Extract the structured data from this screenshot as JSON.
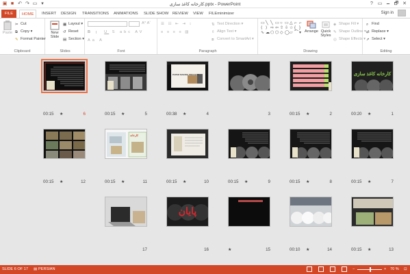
{
  "window": {
    "title": "کارخانه کاغذ سازی.pptx - PowerPoint",
    "help": "?",
    "controls": [
      "🗕",
      "🗗",
      "✕"
    ]
  },
  "tabs": [
    "FILE",
    "HOME",
    "INSERT",
    "DESIGN",
    "TRANSITIONS",
    "ANIMATIONS",
    "SLIDE SHOW",
    "REVIEW",
    "VIEW",
    "FILEminimizer"
  ],
  "active_tab": "HOME",
  "sign_in": "Sign in",
  "ribbon": {
    "clipboard": {
      "paste": "Paste",
      "cut": "Cut",
      "copy": "Copy",
      "format_painter": "Format Painter",
      "label": "Clipboard"
    },
    "slides": {
      "new_slide": "New Slide",
      "layout": "Layout",
      "reset": "Reset",
      "section": "Section",
      "label": "Slides"
    },
    "font": {
      "label": "Font"
    },
    "paragraph": {
      "text_direction": "Text Direction",
      "align_text": "Align Text",
      "convert_smartart": "Convert to SmartArt",
      "label": "Paragraph"
    },
    "drawing": {
      "arrange": "Arrange",
      "quick_styles": "Quick Styles",
      "shape_fill": "Shape Fill",
      "shape_outline": "Shape Outline",
      "shape_effects": "Shape Effects",
      "label": "Drawing"
    },
    "editing": {
      "find": "Find",
      "replace": "Replace",
      "select": "Select",
      "label": "Editing"
    }
  },
  "slides": [
    {
      "number": "6",
      "time": "00:15",
      "star": "★",
      "selected": true
    },
    {
      "number": "5",
      "time": "00:15",
      "star": "★"
    },
    {
      "number": "4",
      "time": "00:38",
      "star": "★"
    },
    {
      "number": "3",
      "time": "",
      "star": ""
    },
    {
      "number": "2",
      "time": "00:15",
      "star": "★"
    },
    {
      "number": "1",
      "time": "00:20",
      "star": "★"
    },
    {
      "number": "12",
      "time": "00:15",
      "star": "★"
    },
    {
      "number": "11",
      "time": "00:15",
      "star": "★"
    },
    {
      "number": "10",
      "time": "00:15",
      "star": "★"
    },
    {
      "number": "9",
      "time": "00:15",
      "star": "★"
    },
    {
      "number": "8",
      "time": "00:15",
      "star": "★"
    },
    {
      "number": "7",
      "time": "00:15",
      "star": "★"
    },
    {
      "number": "17",
      "time": "",
      "star": ""
    },
    {
      "number": "16",
      "time": "",
      "star": ""
    },
    {
      "number": "15",
      "time": "",
      "star": "★"
    },
    {
      "number": "14",
      "time": "00:10",
      "star": "★"
    },
    {
      "number": "13",
      "time": "00:15",
      "star": "★"
    }
  ],
  "thumb_text": {
    "s1": "کارخانه کاغذ سازی",
    "s11": "کارخانه",
    "s16": "پایان",
    "s4": "PAPER MAKING PROCESS"
  },
  "status": {
    "slide_of": "SLIDE 6 OF 17",
    "language": "PERSIAN",
    "zoom": "70 %",
    "zoom_minus": "−",
    "zoom_plus": "+"
  },
  "colors": {
    "accent": "#d24726",
    "selection": "#e8734a"
  }
}
